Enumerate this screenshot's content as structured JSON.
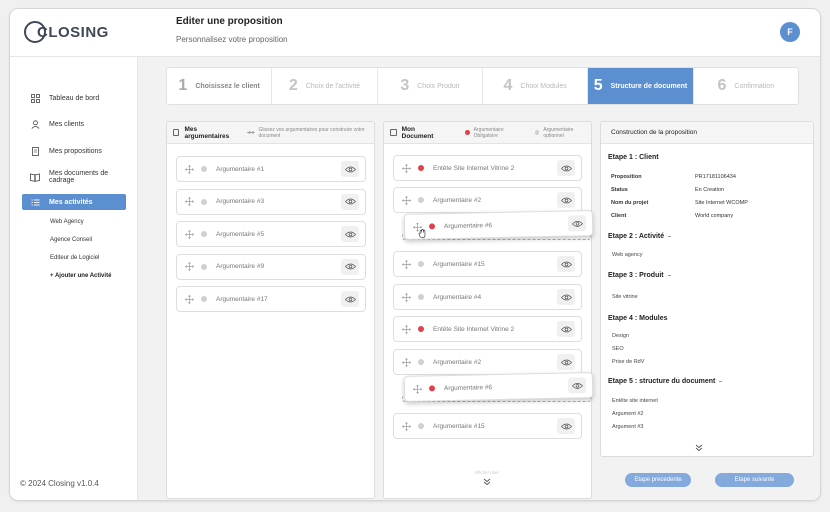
{
  "app": {
    "logo_text": "CLOSING",
    "avatar_letter": "F"
  },
  "header": {
    "title": "Editer une proposition",
    "subtitle": "Personnalisez votre proposition"
  },
  "sidebar": {
    "items": [
      {
        "label": "Tableau de bord",
        "icon": "grid-icon"
      },
      {
        "label": "Mes clients",
        "icon": "user-icon"
      },
      {
        "label": "Mes propositions",
        "icon": "document-icon"
      },
      {
        "label": "Mes documents de cadrage",
        "icon": "book-icon"
      },
      {
        "label": "Mes activités",
        "icon": "list-icon",
        "active": true
      }
    ],
    "sub_items": [
      {
        "label": "Web Agency"
      },
      {
        "label": "Agence Conseil"
      },
      {
        "label": "Editeur de Logiciel"
      },
      {
        "label": "+ Ajouter une Activité",
        "bold": true
      }
    ],
    "copyright": "© 2024 Closing v1.0.4"
  },
  "stepper": {
    "steps": [
      {
        "num": "1",
        "label": "Choisissez le client",
        "state": "done"
      },
      {
        "num": "2",
        "label": "Choix de l'activité",
        "state": "pending"
      },
      {
        "num": "3",
        "label": "Choix Produit",
        "state": "pending"
      },
      {
        "num": "4",
        "label": "Choix Modules",
        "state": "pending"
      },
      {
        "num": "5",
        "label": "Structure de document",
        "state": "active"
      },
      {
        "num": "6",
        "label": "Confirmation",
        "state": "pending"
      }
    ]
  },
  "arguments_panel": {
    "title": "Mes argumentaires",
    "hint": "Glissez vos argumentaires pour construire votre document",
    "cards": [
      {
        "label": "Argumentaire #1"
      },
      {
        "label": "Argumentaire #3"
      },
      {
        "label": "Argumentaire #5"
      },
      {
        "label": "Argumentaire #9"
      },
      {
        "label": "Argumentaire #17"
      }
    ]
  },
  "document_panel": {
    "title": "Mon Document",
    "legend_required": "Argumentaire Obligatoire",
    "legend_optional": "Argumentaire optionnel",
    "cards": [
      {
        "label": "Entête Site Internet Vitrine 2",
        "required": true
      },
      {
        "label": "Argumentaire #2",
        "required": false
      },
      {
        "label": "Argumentaire #6",
        "required": true,
        "lifted": true
      },
      {
        "label": "Argumentaire #15",
        "required": false
      },
      {
        "label": "Argumentaire #4",
        "required": false
      },
      {
        "label": "Entête Site Internet Vitrine 2",
        "required": true
      },
      {
        "label": "Argumentaire #2",
        "required": false
      },
      {
        "label": "Argumentaire #6",
        "required": true,
        "lifted": true
      },
      {
        "label": "Argumentaire #15",
        "required": false
      }
    ],
    "more_text": "Afficher plus"
  },
  "summary_panel": {
    "title": "Construction de la proposition",
    "step1": {
      "title": "Etape 1 : Client",
      "rows": [
        {
          "k": "Proposition",
          "v": "PR17181106434"
        },
        {
          "k": "Status",
          "v": "En Creation"
        },
        {
          "k": "Nom du projet",
          "v": "Site Internet WCOMP"
        },
        {
          "k": "Client",
          "v": "World company"
        }
      ]
    },
    "step2": {
      "title": "Etape 2 : Activité",
      "items": [
        "Web agency"
      ]
    },
    "step3": {
      "title": "Etape 3 : Produit",
      "items": [
        "Site vitrine"
      ]
    },
    "step4": {
      "title": "Etape 4 : Modules",
      "items": [
        "Design",
        "SEO",
        "Prise de RdV"
      ]
    },
    "step5": {
      "title": "Etape 5 : structure du document",
      "items": [
        "Entête site internet",
        "Argument #2",
        "Argument #3"
      ]
    }
  },
  "buttons": {
    "prev": "Etape precedente",
    "next": "Etape suivante"
  },
  "colors": {
    "accent": "#5b8fd0",
    "required_dot": "#e0414a",
    "optional_dot": "#d0d0d0",
    "button": "#84a9dc"
  }
}
